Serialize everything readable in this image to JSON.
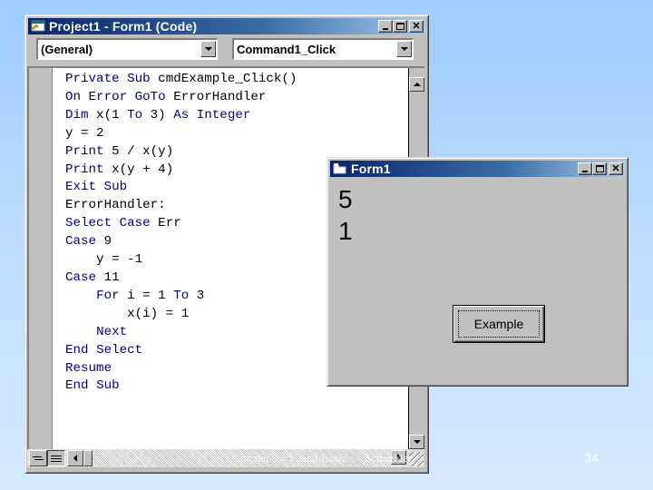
{
  "code_window": {
    "title": "Project1 - Form1 (Code)",
    "object_combo": "(General)",
    "procedure_combo": "Command1_Click",
    "code_lines": [
      "Private Sub cmdExample_Click()",
      "On Error GoTo ErrorHandler",
      "Dim x(1 To 3) As Integer",
      "y = 2",
      "Print 5 / x(y)",
      "Print x(y + 4)",
      "Exit Sub",
      "ErrorHandler:",
      "Select Case Err",
      "Case 9",
      "    y = -1",
      "Case 11",
      "    For i = 1 To 3",
      "        x(i) = 1",
      "    Next",
      "End Select",
      "Resume",
      "End Sub"
    ]
  },
  "form_window": {
    "title": "Form1",
    "output_lines": [
      "5",
      "1"
    ],
    "button_label": "Example"
  },
  "slide": {
    "footer": "Chapter 9 - Visual Basic      Schneider",
    "page_number": "34"
  },
  "colors": {
    "keyword": "#000080",
    "titlebar_active": "#0a246a",
    "window_face": "#c0c0c0"
  }
}
